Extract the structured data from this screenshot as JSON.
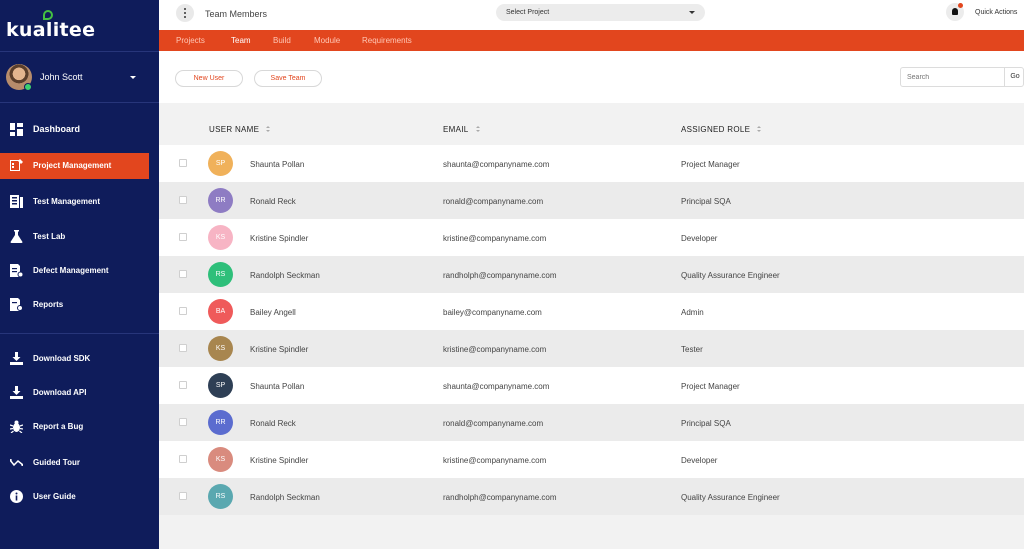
{
  "app": {
    "logo_text": "kualitee",
    "page_title": "Team Members",
    "select_project_label": "Select Project",
    "quick_actions_label": "Quick Actions"
  },
  "user": {
    "name": "John Scott"
  },
  "nav": {
    "items": [
      {
        "label": "Dashboard",
        "icon": "dashboard-icon"
      },
      {
        "label": "Project Management",
        "icon": "project-management-icon",
        "active": true
      },
      {
        "label": "Test Management",
        "icon": "test-management-icon"
      },
      {
        "label": "Test Lab",
        "icon": "flask-icon"
      },
      {
        "label": "Defect Management",
        "icon": "defect-icon"
      },
      {
        "label": "Reports",
        "icon": "reports-icon"
      }
    ],
    "secondary": [
      {
        "label": "Download SDK",
        "icon": "download-sdk-icon"
      },
      {
        "label": "Download API",
        "icon": "download-api-icon"
      },
      {
        "label": "Report a Bug",
        "icon": "bug-icon"
      },
      {
        "label": "Guided Tour",
        "icon": "tour-icon"
      },
      {
        "label": "User Guide",
        "icon": "info-icon"
      }
    ]
  },
  "tabs": [
    {
      "label": "Projects"
    },
    {
      "label": "Team",
      "active": true
    },
    {
      "label": "Build"
    },
    {
      "label": "Module"
    },
    {
      "label": "Requirements"
    }
  ],
  "toolbar": {
    "new_user_label": "New User",
    "save_team_label": "Save Team",
    "search_placeholder": "Search",
    "go_label": "Go"
  },
  "table": {
    "columns": [
      "USER NAME",
      "EMAIL",
      "ASSIGNED ROLE"
    ],
    "rows": [
      {
        "initials": "SP",
        "name": "Shaunta Pollan",
        "email": "shaunta@companyname.com",
        "role": "Project Manager",
        "color": "#f0b15a"
      },
      {
        "initials": "RR",
        "name": "Ronald Reck",
        "email": "ronald@companyname.com",
        "role": "Principal SQA",
        "color": "#8e7cc3"
      },
      {
        "initials": "KS",
        "name": "Kristine Spindler",
        "email": "kristine@companyname.com",
        "role": "Developer",
        "color": "#f7b4c4"
      },
      {
        "initials": "RS",
        "name": "Randolph Seckman",
        "email": "randholph@companyname.com",
        "role": "Quality Assurance Engineer",
        "color": "#2ebf7a"
      },
      {
        "initials": "BA",
        "name": "Bailey Angell",
        "email": "bailey@companyname.com",
        "role": "Admin",
        "color": "#ef5a5a"
      },
      {
        "initials": "KS",
        "name": "Kristine Spindler",
        "email": "kristine@companyname.com",
        "role": "Tester",
        "color": "#a8864f"
      },
      {
        "initials": "SP",
        "name": "Shaunta Pollan",
        "email": "shaunta@companyname.com",
        "role": "Project Manager",
        "color": "#2e3f55"
      },
      {
        "initials": "RR",
        "name": "Ronald Reck",
        "email": "ronald@companyname.com",
        "role": "Principal SQA",
        "color": "#5b6ccf"
      },
      {
        "initials": "KS",
        "name": "Kristine Spindler",
        "email": "kristine@companyname.com",
        "role": "Developer",
        "color": "#d98b7e"
      },
      {
        "initials": "RS",
        "name": "Randolph Seckman",
        "email": "randholph@companyname.com",
        "role": "Quality Assurance Engineer",
        "color": "#5aa8b0"
      }
    ]
  },
  "colors": {
    "sidebar": "#0f1c5b",
    "accent": "#e2461e"
  }
}
